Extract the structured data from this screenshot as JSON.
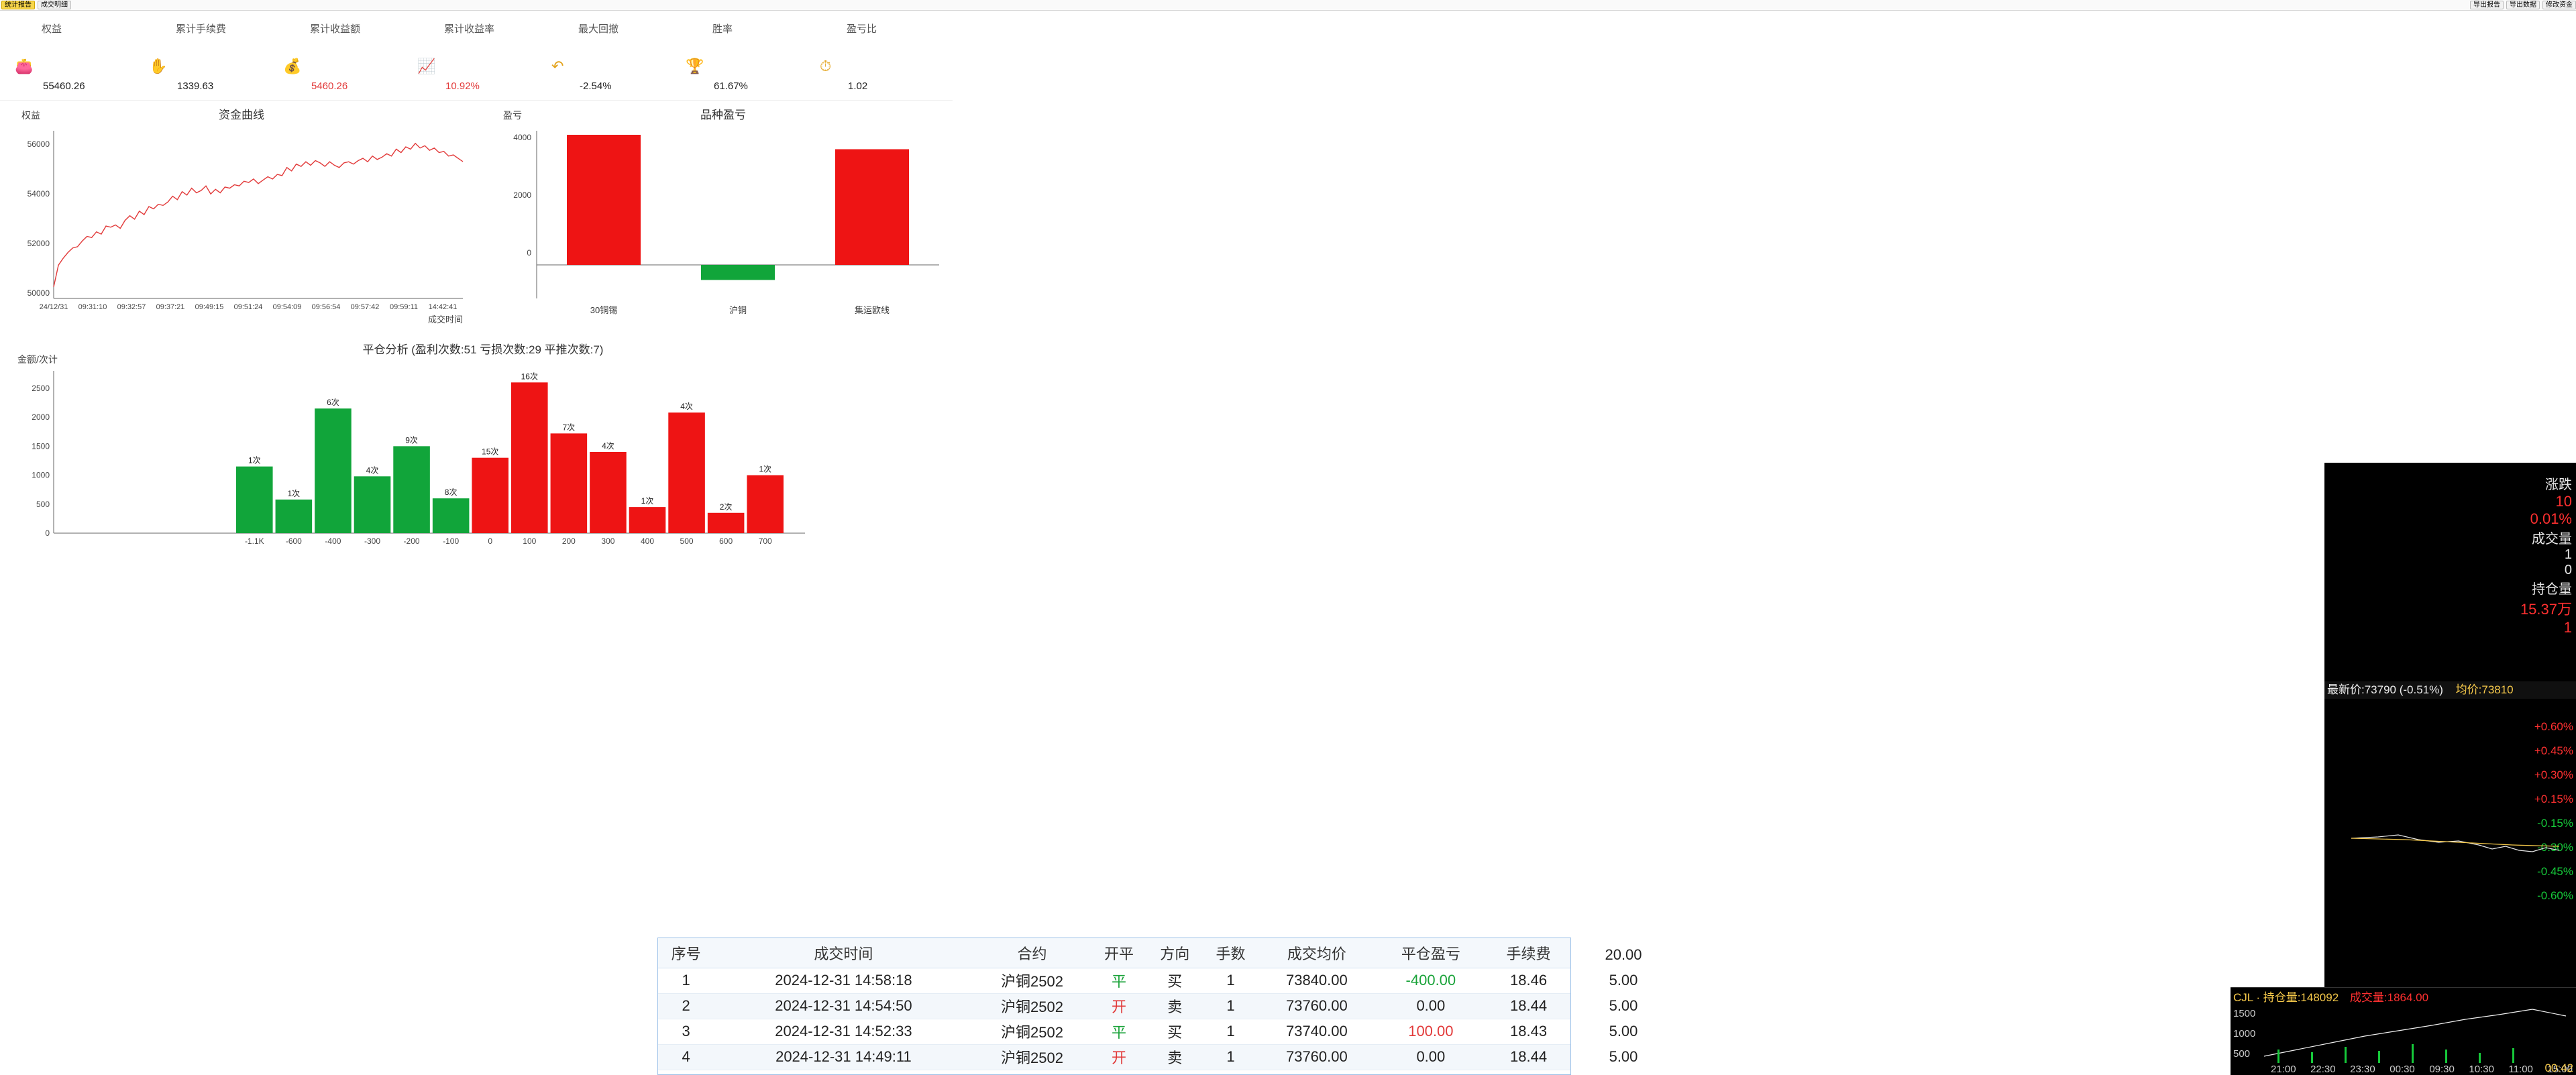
{
  "toolbar": {
    "left_buttons": [
      "统计报告",
      "成交明细"
    ],
    "right_buttons": [
      "导出报告",
      "导出数据",
      "修改资金"
    ]
  },
  "metrics": [
    {
      "label": "权益",
      "value": "55460.26",
      "icon": "wallet-icon",
      "highlight": false
    },
    {
      "label": "累计手续费",
      "value": "1339.63",
      "icon": "hand-coin-icon",
      "highlight": false
    },
    {
      "label": "累计收益额",
      "value": "5460.26",
      "icon": "money-bag-icon",
      "highlight": true
    },
    {
      "label": "累计收益率",
      "value": "10.92%",
      "icon": "bar-chart-icon",
      "highlight": true
    },
    {
      "label": "最大回撤",
      "value": "-2.54%",
      "icon": "drawdown-arrow-icon",
      "highlight": false
    },
    {
      "label": "胜率",
      "value": "61.67%",
      "icon": "trophy-icon",
      "highlight": false
    },
    {
      "label": "盈亏比",
      "value": "1.02",
      "icon": "gauge-icon",
      "highlight": false
    }
  ],
  "equity_chart": {
    "title": "资金曲线",
    "ylabel": "权益",
    "xlabel": "成交时间",
    "yticks": [
      "56000",
      "54000",
      "52000",
      "50000"
    ],
    "xticks": [
      "24/12/31",
      "09:31:10",
      "09:32:57",
      "09:37:21",
      "09:49:15",
      "09:51:24",
      "09:54:09",
      "09:56:54",
      "09:57:42",
      "09:59:11",
      "14:42:41"
    ]
  },
  "pnl_chart": {
    "title": "品种盈亏",
    "ylabel": "盈亏",
    "yticks": [
      "4000",
      "2000",
      "0"
    ]
  },
  "close_chart": {
    "title": "平仓分析 (盈利次数:51 亏损次数:29 平推次数:7)",
    "ylabel": "金额/次计",
    "yticks": [
      "2500",
      "2000",
      "1500",
      "1000",
      "500",
      "0"
    ],
    "xticks": [
      "-1.1K",
      "-600",
      "-400",
      "-300",
      "-200",
      "-100",
      "0",
      "100",
      "200",
      "300",
      "400",
      "500",
      "600",
      "700"
    ]
  },
  "chart_data": [
    {
      "type": "line",
      "title": "资金曲线",
      "xlabel": "成交时间",
      "ylabel": "权益",
      "ylim": [
        49500,
        56800
      ],
      "x": [
        0,
        1,
        2,
        3,
        4,
        5,
        6,
        7,
        8,
        9,
        10,
        11,
        12,
        13,
        14,
        15,
        16,
        17,
        18,
        19,
        20,
        21,
        22,
        23,
        24,
        25,
        26,
        27,
        28,
        29,
        30,
        31,
        32,
        33,
        34,
        35,
        36,
        37,
        38,
        39,
        40,
        41,
        42,
        43,
        44,
        45,
        46,
        47,
        48,
        49,
        50,
        51,
        52,
        53,
        54,
        55,
        56,
        57,
        58,
        59,
        60,
        61,
        62,
        63,
        64,
        65,
        66,
        67,
        68,
        69,
        70,
        71,
        72,
        73,
        74,
        75,
        76,
        77,
        78,
        79,
        80,
        81,
        82,
        83,
        84,
        85,
        86
      ],
      "y": [
        50000,
        50950,
        51250,
        51500,
        51700,
        51750,
        52000,
        52200,
        52150,
        52400,
        52300,
        52650,
        52600,
        52700,
        52550,
        52900,
        53100,
        52950,
        53300,
        53150,
        53500,
        53400,
        53600,
        53550,
        53700,
        53950,
        53800,
        54150,
        54000,
        54300,
        54100,
        54200,
        54400,
        54050,
        54250,
        54100,
        54350,
        54300,
        54450,
        54400,
        54600,
        54550,
        54700,
        54500,
        54650,
        54800,
        54700,
        54900,
        54850,
        55200,
        55050,
        55350,
        55250,
        55450,
        55300,
        55500,
        55400,
        55250,
        55450,
        55300,
        55200,
        55400,
        55450,
        55350,
        55500,
        55600,
        55450,
        55700,
        55550,
        55650,
        55800,
        55700,
        56000,
        55850,
        56100,
        56000,
        56250,
        56050,
        56150,
        55950,
        56050,
        55850,
        55900,
        55700,
        55750,
        55600,
        55460
      ]
    },
    {
      "type": "bar",
      "title": "品种盈亏",
      "ylabel": "盈亏",
      "categories": [
        "30铜锡",
        "沪铜",
        "集运欧线"
      ],
      "values": [
        3880,
        -450,
        3450
      ],
      "ylim": [
        -1000,
        4000
      ]
    },
    {
      "type": "bar",
      "title": "平仓分析 (盈利次数:51 亏损次数:29 平推次数:7)",
      "ylabel": "金额/次计",
      "categories": [
        "-1.1K",
        "-600",
        "-400",
        "-300",
        "-200",
        "-100",
        "0",
        "100",
        "200",
        "300",
        "400",
        "500",
        "600",
        "700"
      ],
      "values": [
        1150,
        580,
        2150,
        980,
        1500,
        600,
        1300,
        2600,
        1720,
        1400,
        450,
        2080,
        350,
        1000
      ],
      "labels": [
        "1次",
        "1次",
        "6次",
        "4次",
        "9次",
        "8次",
        "15次",
        "16次",
        "7次",
        "4次",
        "1次",
        "4次",
        "2次",
        "1次"
      ],
      "colors": [
        "#11a53a",
        "#11a53a",
        "#11a53a",
        "#11a53a",
        "#11a53a",
        "#11a53a",
        "#ee1414",
        "#ee1414",
        "#ee1414",
        "#ee1414",
        "#ee1414",
        "#ee1414",
        "#ee1414",
        "#ee1414"
      ],
      "ylim": [
        0,
        2800
      ]
    }
  ],
  "trade_table": {
    "headers": [
      "序号",
      "成交时间",
      "合约",
      "开平",
      "方向",
      "手数",
      "成交均价",
      "平仓盈亏",
      "手续费"
    ],
    "rows": [
      [
        "1",
        "2024-12-31 14:58:18",
        "沪铜2502",
        "平",
        "买",
        "1",
        "73840.00",
        "-400.00",
        "18.46"
      ],
      [
        "2",
        "2024-12-31 14:54:50",
        "沪铜2502",
        "开",
        "卖",
        "1",
        "73760.00",
        "0.00",
        "18.44"
      ],
      [
        "3",
        "2024-12-31 14:52:33",
        "沪铜2502",
        "平",
        "买",
        "1",
        "73740.00",
        "100.00",
        "18.43"
      ],
      [
        "4",
        "2024-12-31 14:49:11",
        "沪铜2502",
        "开",
        "卖",
        "1",
        "73760.00",
        "0.00",
        "18.44"
      ]
    ]
  },
  "side_fees": [
    "20.00",
    "5.00",
    "5.00",
    "5.00",
    "5.00"
  ],
  "quote_panel": {
    "labels": [
      "涨跌",
      "成交量",
      "持仓量"
    ],
    "values": [
      "10",
      "0.01%",
      "1",
      "0",
      "15.37万",
      "1"
    ],
    "price_bar": "最新价:73790 (-0.51%)",
    "avg_label": "均价:73810",
    "percents": [
      "+0.60%",
      "+0.45%",
      "+0.30%",
      "+0.15%",
      "-0.15%",
      "-0.30%",
      "-0.45%",
      "-0.60%"
    ],
    "sub_title": "CJL · 持仓量:148092",
    "sub_volume": "成交量:1864.00",
    "time_axis": [
      "21:00",
      "22:30",
      "23:30",
      "00:30",
      "09:30",
      "10:30",
      "11:00",
      "15:00"
    ],
    "sub_yticks": [
      "1500",
      "1000",
      "500"
    ],
    "clock": "00:42"
  },
  "colors": {
    "up": "#ee1414",
    "down": "#11a53a",
    "accent": "#e3a21a",
    "line": "#e23a3a"
  }
}
